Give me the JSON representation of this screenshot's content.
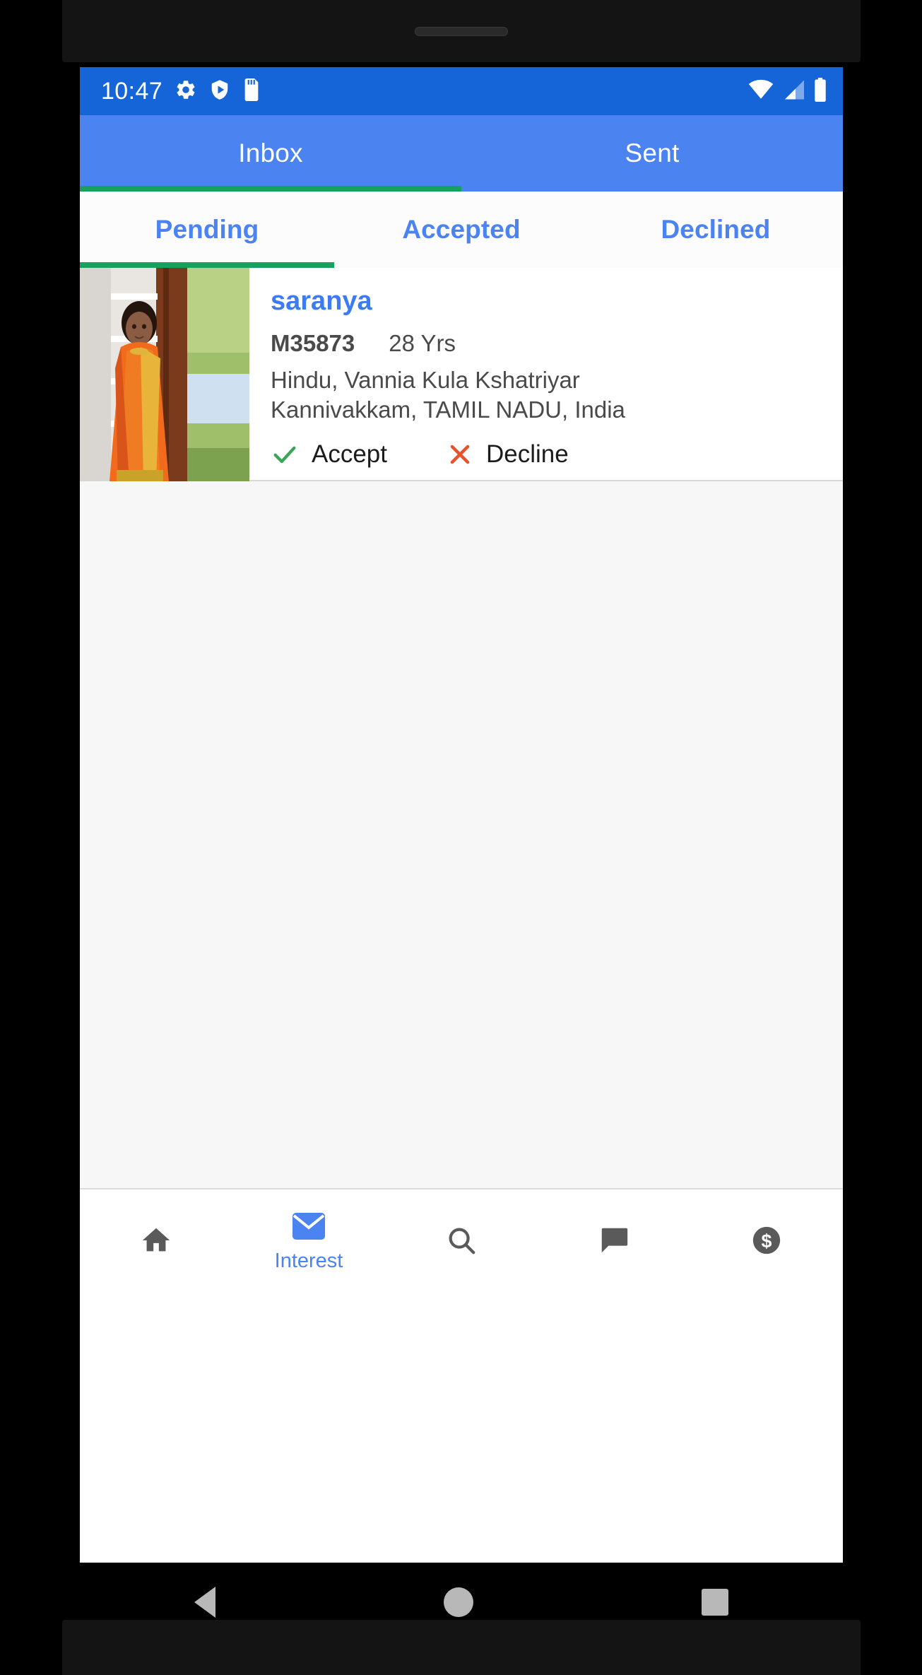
{
  "status_bar": {
    "time": "10:47",
    "left_icons": [
      "gear-icon",
      "play-protect-shield-icon",
      "sd-card-icon"
    ],
    "right_icons": [
      "wifi-icon",
      "cellular-signal-icon",
      "battery-icon"
    ],
    "background_color": "#1565d8"
  },
  "top_tabs": {
    "items": [
      {
        "label": "Inbox",
        "selected": true
      },
      {
        "label": "Sent",
        "selected": false
      }
    ],
    "indicator_color": "#17a05e",
    "background_color": "#4b83f0"
  },
  "sub_tabs": {
    "items": [
      {
        "label": "Pending",
        "selected": true
      },
      {
        "label": "Accepted",
        "selected": false
      },
      {
        "label": "Declined",
        "selected": false
      }
    ],
    "indicator_color": "#17a05e",
    "text_color": "#4b83f0"
  },
  "list": {
    "cards": [
      {
        "name": "saranya",
        "profile_id": "M35873",
        "age": "28 Yrs",
        "religion_caste": "Hindu, Vannia Kula Kshatriyar",
        "location": "Kannivakkam, TAMIL NADU, India",
        "accept_label": "Accept",
        "decline_label": "Decline",
        "accept_color": "#3aa757",
        "decline_color": "#e8522a"
      }
    ]
  },
  "bottom_nav": {
    "items": [
      {
        "icon": "home-icon",
        "label": "",
        "selected": false
      },
      {
        "icon": "mail-envelope-icon",
        "label": "Interest",
        "selected": true
      },
      {
        "icon": "search-icon",
        "label": "",
        "selected": false
      },
      {
        "icon": "chat-bubble-icon",
        "label": "",
        "selected": false
      },
      {
        "icon": "dollar-coin-icon",
        "label": "",
        "selected": false
      }
    ],
    "active_color": "#4b83f0",
    "inactive_color": "#5a5a5a"
  },
  "android_nav": {
    "buttons": [
      "back-button",
      "home-button",
      "recents-button"
    ]
  }
}
